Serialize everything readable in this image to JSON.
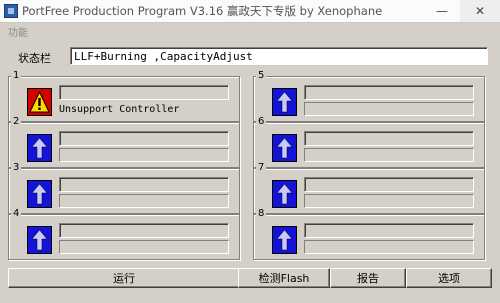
{
  "window": {
    "title": "PortFree Production Program V3.16 赢政天下专版 by Xenophane"
  },
  "menu": {
    "label": "功能"
  },
  "status": {
    "label": "状态栏",
    "value": "LLF+Burning  ,CapacityAdjust"
  },
  "ports": [
    {
      "number": "1",
      "state": "warning",
      "message": "Unsupport Controller"
    },
    {
      "number": "2",
      "state": "idle",
      "message": ""
    },
    {
      "number": "3",
      "state": "idle",
      "message": ""
    },
    {
      "number": "4",
      "state": "idle",
      "message": ""
    },
    {
      "number": "5",
      "state": "idle",
      "message": ""
    },
    {
      "number": "6",
      "state": "idle",
      "message": ""
    },
    {
      "number": "7",
      "state": "idle",
      "message": ""
    },
    {
      "number": "8",
      "state": "idle",
      "message": ""
    }
  ],
  "buttons": {
    "run": "运行",
    "detect_flash": "检测Flash",
    "report": "报告",
    "options": "选项"
  },
  "icons": {
    "app": "app-icon",
    "idle": "arrow-up-icon",
    "warning": "warning-icon"
  },
  "colors": {
    "idle_icon": "#1414d8",
    "warning_icon": "#d40000"
  }
}
